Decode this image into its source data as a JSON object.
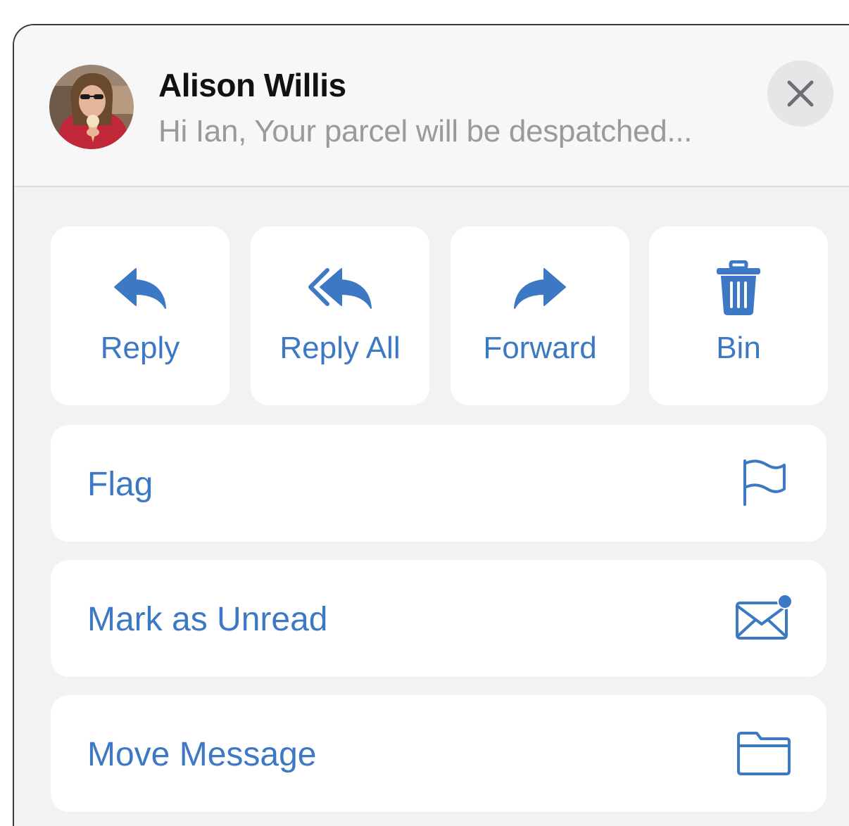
{
  "header": {
    "sender_name": "Alison Willis",
    "preview_text": "Hi Ian, Your parcel will be despatched...",
    "avatar_icon": "person-photo",
    "close_icon": "close-icon"
  },
  "actions": [
    {
      "label": "Reply",
      "icon": "reply-icon"
    },
    {
      "label": "Reply All",
      "icon": "reply-all-icon"
    },
    {
      "label": "Forward",
      "icon": "forward-icon"
    },
    {
      "label": "Bin",
      "icon": "trash-icon"
    }
  ],
  "menu": [
    {
      "label": "Flag",
      "icon": "flag-icon"
    },
    {
      "label": "Mark as Unread",
      "icon": "envelope-unread-icon"
    },
    {
      "label": "Move Message",
      "icon": "folder-icon"
    }
  ],
  "colors": {
    "accent": "#3c78c4",
    "sheet_background": "#f2f2f4",
    "tile_background": "#ffffff",
    "preview_text": "#9a9a9e"
  }
}
